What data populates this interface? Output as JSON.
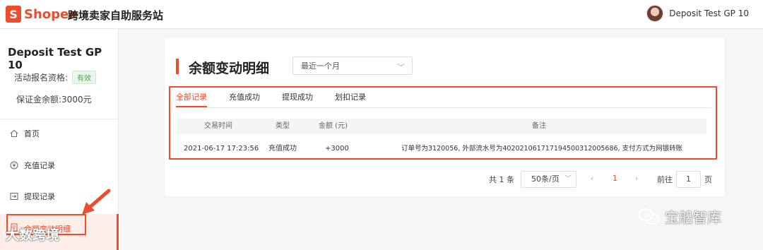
{
  "header": {
    "logo_text": "Shopee",
    "logo_mark": "S",
    "site_title": "跨境卖家自助服务站",
    "user_name": "Deposit Test GP 10"
  },
  "sidebar": {
    "shop_name": "Deposit Test GP 10",
    "activity_label": "活动报名资格:",
    "activity_badge": "有效",
    "deposit_label": "保证金余额:3000元",
    "items": [
      {
        "label": "首页",
        "icon": "home-icon"
      },
      {
        "label": "充值记录",
        "icon": "yen-icon"
      },
      {
        "label": "提现记录",
        "icon": "withdraw-icon"
      },
      {
        "label": "余额变动明细",
        "icon": "document-icon"
      }
    ]
  },
  "main": {
    "title": "余额变动明细",
    "period_select": "最近一个月",
    "tabs": [
      "全部记录",
      "充值成功",
      "提现成功",
      "划扣记录"
    ],
    "active_tab": "全部记录",
    "table": {
      "columns": [
        "交易时间",
        "类型",
        "金额 (元)",
        "备注"
      ],
      "rows": [
        {
          "time": "2021-06-17 17:23:56",
          "type": "充值成功",
          "amount": "+3000",
          "note": "订单号为3120056, 外部流水号为4020210617171945003120056​86, 支付方式为网银转账"
        }
      ]
    },
    "pagination": {
      "total": "共 1 条",
      "page_size": "50条/页",
      "current_page": "1",
      "goto_label": "前往",
      "goto_value": "1",
      "page_suffix": "页"
    }
  },
  "watermarks": {
    "right": "宝船智库",
    "left": "大数跨境"
  },
  "colors": {
    "brand": "#ee4d2d",
    "badge_green": "#52a352"
  }
}
